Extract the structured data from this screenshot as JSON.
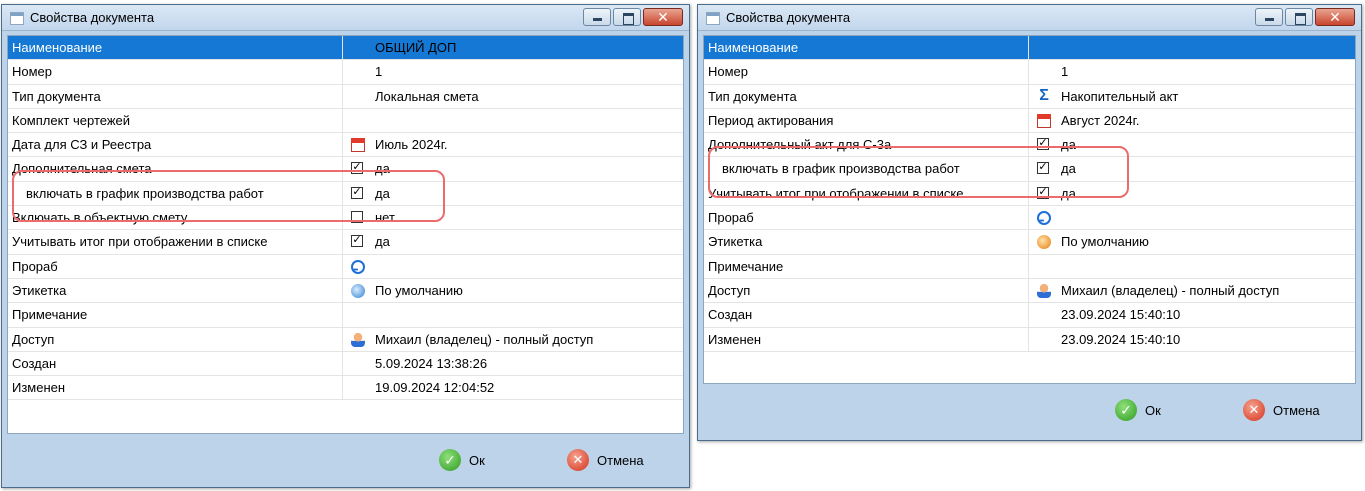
{
  "dialog1": {
    "title": "Свойства документа",
    "rows": [
      {
        "label": "Наименование",
        "value": "ОБЩИЙ ДОП"
      },
      {
        "label": "Номер",
        "value": "1"
      },
      {
        "label": "Тип документа",
        "value": "Локальная смета"
      },
      {
        "label": "Комплект чертежей",
        "value": ""
      },
      {
        "label": "Дата для СЗ и Реестра",
        "value": "Июль 2024г."
      },
      {
        "label": "Дополнительная смета",
        "value": "да"
      },
      {
        "label": "включать в график производства работ",
        "value": "да"
      },
      {
        "label": "Включать в объектную смету",
        "value": "нет"
      },
      {
        "label": "Учитывать итог при отображении в списке",
        "value": "да"
      },
      {
        "label": "Прораб",
        "value": ""
      },
      {
        "label": "Этикетка",
        "value": "По умолчанию"
      },
      {
        "label": "Примечание",
        "value": ""
      },
      {
        "label": "Доступ",
        "value": "Михаил (владелец) - полный доступ"
      },
      {
        "label": "Создан",
        "value": "5.09.2024 13:38:26"
      },
      {
        "label": "Изменен",
        "value": "19.09.2024 12:04:52"
      }
    ],
    "ok_label": "Ок",
    "cancel_label": "Отмена"
  },
  "dialog2": {
    "title": "Свойства документа",
    "rows": [
      {
        "label": "Наименование",
        "value": ""
      },
      {
        "label": "Номер",
        "value": "1"
      },
      {
        "label": "Тип документа",
        "value": "Накопительный акт"
      },
      {
        "label": "Период актирования",
        "value": "Август 2024г."
      },
      {
        "label": "Дополнительный акт для С-3а",
        "value": "да"
      },
      {
        "label": "включать в график производства работ",
        "value": "да"
      },
      {
        "label": "Учитывать итог при отображении в списке",
        "value": "да"
      },
      {
        "label": "Прораб",
        "value": ""
      },
      {
        "label": "Этикетка",
        "value": "По умолчанию"
      },
      {
        "label": "Примечание",
        "value": ""
      },
      {
        "label": "Доступ",
        "value": "Михаил (владелец) - полный доступ"
      },
      {
        "label": "Создан",
        "value": "23.09.2024 15:40:10"
      },
      {
        "label": "Изменен",
        "value": "23.09.2024 15:40:10"
      }
    ],
    "ok_label": "Ок",
    "cancel_label": "Отмена"
  },
  "colors": {
    "selection": "#1478d4",
    "highlight": "#ec6b6b"
  }
}
